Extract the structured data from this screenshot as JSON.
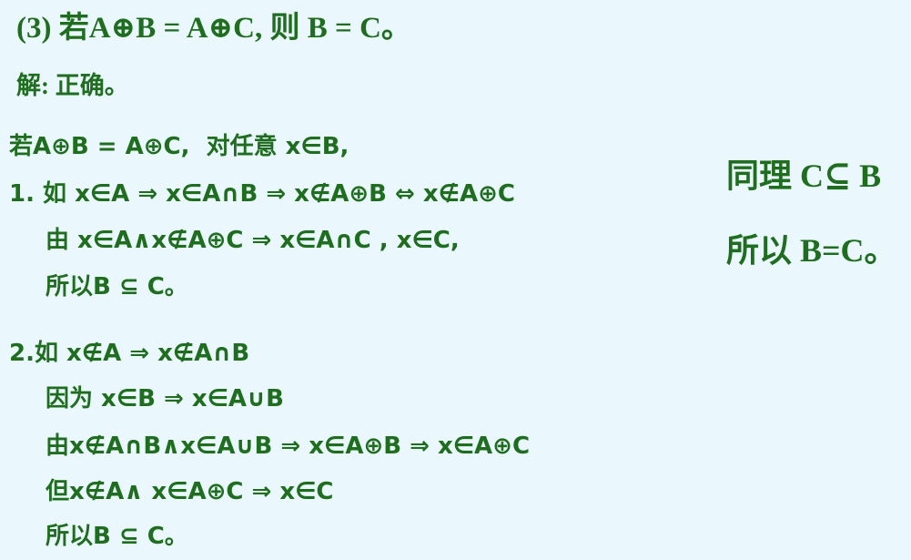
{
  "problem": {
    "title": "(3) 若A⊕B = A⊕C, 则 B = C。"
  },
  "answer": {
    "text": "解: 正确。"
  },
  "proof": {
    "intro": "若A⊕B = A⊕C,  对任意 x∈B,",
    "case1": {
      "line1": "1. 如 x∈A ⇒ x∈A∩B ⇒ x∉A⊕B ⇔ x∉A⊕C",
      "line2": "由 x∈A∧x∉A⊕C ⇒ x∈A∩C , x∈C,",
      "line3": "所以B ⊆ C。"
    },
    "case2": {
      "line1": "2.如 x∉A ⇒ x∉A∩B",
      "line2": "因为 x∈B ⇒ x∈A∪B",
      "line3": "由x∉A∩B∧x∈A∪B ⇒ x∈A⊕B ⇒ x∈A⊕C",
      "line4": "但x∉A∧ x∈A⊕C ⇒ x∈C",
      "line5": "所以B ⊆ C。"
    }
  },
  "side_notes": {
    "similarly": "同理 C⊆ B",
    "therefore": "所以 B=C。"
  }
}
